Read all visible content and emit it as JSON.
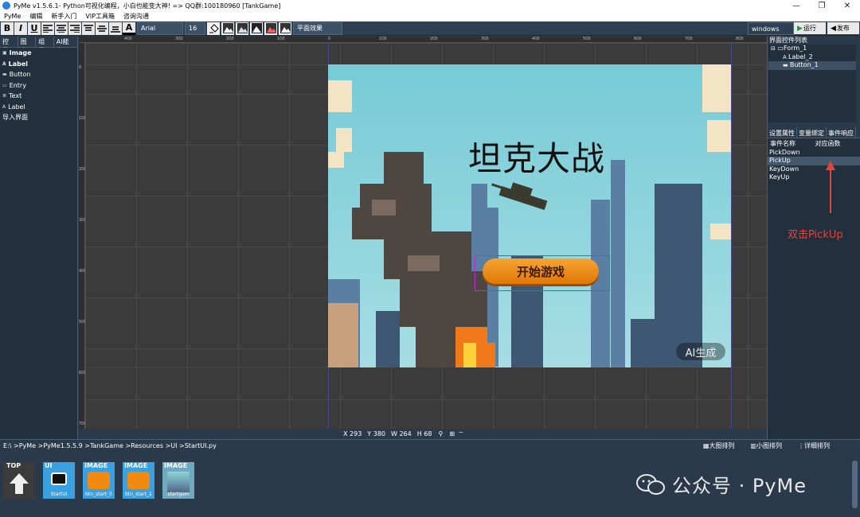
{
  "window": {
    "title": "PyMe v1.5.6.1- Python可视化编程，小白也能变大神!  => QQ群:100180960   [TankGame]",
    "minimize": "—",
    "maximize": "❐",
    "close": "✕"
  },
  "menu": [
    "PyMe",
    "编辑",
    "新手入门",
    "VIP工具箱",
    "咨询沟通"
  ],
  "toolbar": {
    "bold": "B",
    "italic": "I",
    "underline": "U",
    "font_name": "Arial",
    "font_size": "16",
    "effect": "平面效果",
    "platform": "windows",
    "run": "运行",
    "publish": "发布",
    "font_color_glyph": "A"
  },
  "left_tabs": [
    "控件",
    "图表",
    "组件",
    "AI能力"
  ],
  "left_items": [
    {
      "icon": "▣",
      "label": "Image",
      "bold": true
    },
    {
      "icon": "A",
      "label": "Label",
      "bold": true
    },
    {
      "icon": "▬",
      "label": "Button",
      "bold": false
    },
    {
      "icon": "▭",
      "label": "Entry",
      "bold": false
    },
    {
      "icon": "≣",
      "label": "Text",
      "bold": false
    },
    {
      "icon": "A",
      "label": "Label",
      "bold": false
    },
    {
      "icon": "",
      "label": "导入界面",
      "bold": false
    }
  ],
  "ruler": {
    "top_ticks": [
      "400",
      "300",
      "200",
      "100",
      "0",
      "100",
      "200",
      "300",
      "400",
      "500",
      "600",
      "700",
      "800"
    ],
    "left_ticks": [
      "0",
      "100",
      "200",
      "300",
      "400",
      "500",
      "600",
      "700"
    ]
  },
  "form": {
    "title_text": "坦克大战",
    "start_button": "开始游戏",
    "ai_badge": "AI生成"
  },
  "status": {
    "x": "X 293",
    "y": "Y 380",
    "w": "W 264",
    "h": "H 68"
  },
  "right_panel": {
    "tree_header": "界面控件列表",
    "tree": [
      {
        "label": "Form_1",
        "indent": 0
      },
      {
        "label": "Label_2",
        "indent": 1
      },
      {
        "label": "Button_1",
        "indent": 1
      }
    ],
    "tabs": [
      "设置属性",
      "变量绑定",
      "事件响应"
    ],
    "event_columns": [
      "事件名称",
      "对应函数"
    ],
    "events": [
      "PickDown",
      "PickUp",
      "KeyDown",
      "KeyUp"
    ],
    "annotation": "双击PickUp"
  },
  "bottom": {
    "path": "E:\\ >PyMe >PyMe1.5.5.9 >TankGame >Resources >UI >StartUI.py",
    "view_buttons": [
      "大图排列",
      "小图排列",
      "详细排列"
    ],
    "files": [
      {
        "type": "TOP",
        "name": ""
      },
      {
        "type": "UI",
        "name": "StartUI"
      },
      {
        "type": "IMAGE",
        "name": "btn_start_0"
      },
      {
        "type": "IMAGE",
        "name": "btn_start_1"
      },
      {
        "type": "IMAGE",
        "name": "startgam"
      }
    ],
    "watermark": "公众号 · PyMe"
  },
  "colors": {
    "accent_red": "#e0443c",
    "button_orange": "#f08a10",
    "selection_magenta": "#c02bd0",
    "panel_bg": "#2b3a4a"
  }
}
